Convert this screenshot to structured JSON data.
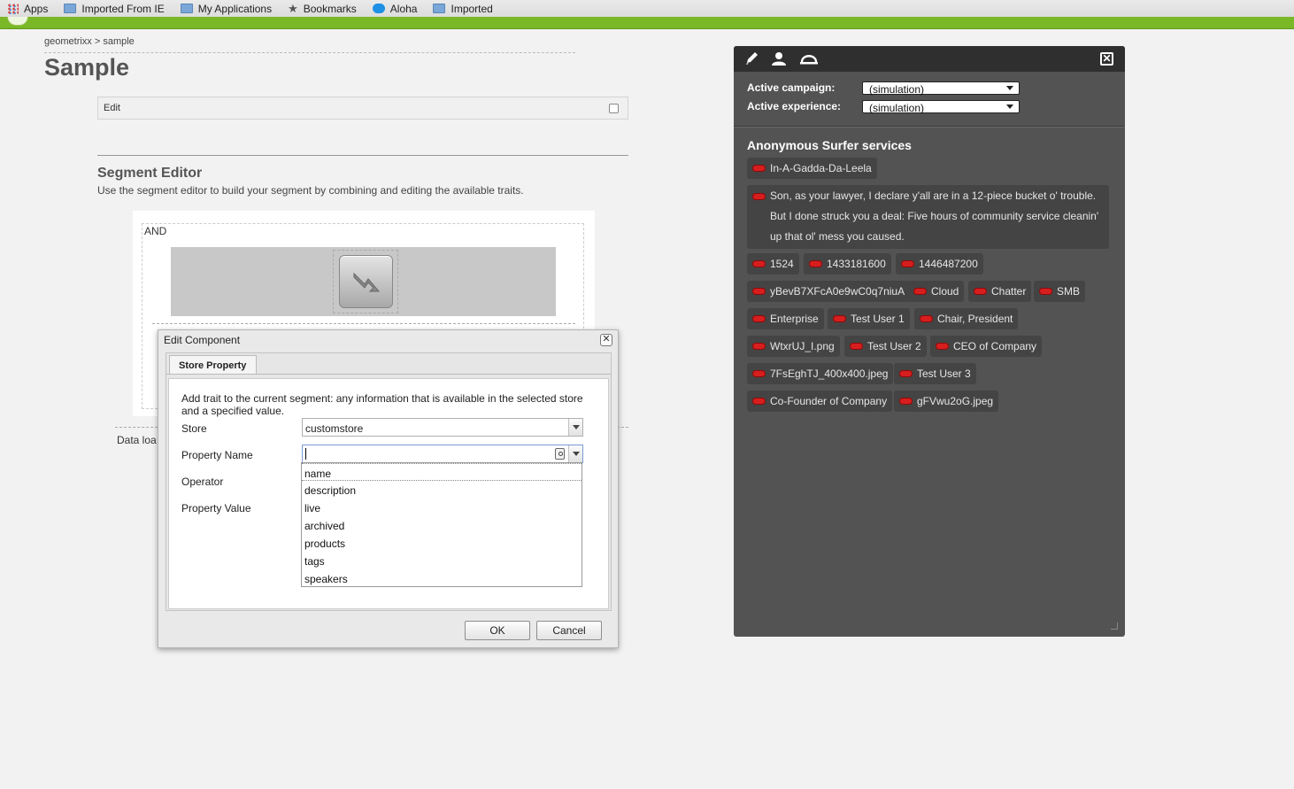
{
  "bookmarks": [
    {
      "label": "Apps",
      "icon": "apps-grid-icon"
    },
    {
      "label": "Imported From IE",
      "icon": "folder-icon"
    },
    {
      "label": "My Applications",
      "icon": "folder-icon"
    },
    {
      "label": "Bookmarks",
      "icon": "star-icon"
    },
    {
      "label": "Aloha",
      "icon": "cloud-icon"
    },
    {
      "label": "Imported",
      "icon": "folder-icon"
    }
  ],
  "page": {
    "breadcrumb": "geometrixx > sample",
    "title": "Sample",
    "edit_bar_label": "Edit",
    "segment_title": "Segment Editor",
    "segment_desc": "Use the segment editor to build your segment by combining and editing the available traits.",
    "and_label": "AND",
    "data_loaded": "Data loa"
  },
  "dialog": {
    "title": "Edit Component",
    "close": "✕",
    "tab": "Store Property",
    "help": "Add trait to the current segment: any information that is available in the selected store and a specified value.",
    "fields": {
      "store_label": "Store",
      "store_value": "customstore",
      "property_name_label": "Property Name",
      "property_name_value": "",
      "operator_label": "Operator",
      "property_value_label": "Property Value"
    },
    "dropdown_options": [
      "name",
      "description",
      "live",
      "archived",
      "products",
      "tags",
      "speakers"
    ],
    "ok": "OK",
    "cancel": "Cancel"
  },
  "panel": {
    "icons": [
      "pencil-icon",
      "user-icon",
      "undo-icon"
    ],
    "close": "✕",
    "active_campaign_label": "Active campaign:",
    "active_campaign_value": "(simulation)",
    "active_experience_label": "Active experience:",
    "active_experience_value": "(simulation)",
    "services_title": "Anonymous Surfer services",
    "toggle_color": "#d71e1e",
    "chips": [
      "In-A-Gadda-Da-Leela",
      "Son, as your lawyer, I declare y'all are in a 12-piece bucket o' trouble. But I done struck you a deal: Five hours of community service cleanin' up that ol' mess you caused.",
      "1524",
      "1433181600",
      "1446487200",
      "yBevB7XFcA0e9wC0q7niuA",
      "Cloud",
      "Chatter",
      "SMB",
      "Enterprise",
      "Test User 1",
      "Chair, President",
      "WtxrUJ_I.png",
      "Test User 2",
      "CEO of Company",
      "7FsEghTJ_400x400.jpeg",
      "Test User 3",
      "Co-Founder of Company",
      "gFVwu2oG.jpeg"
    ]
  }
}
